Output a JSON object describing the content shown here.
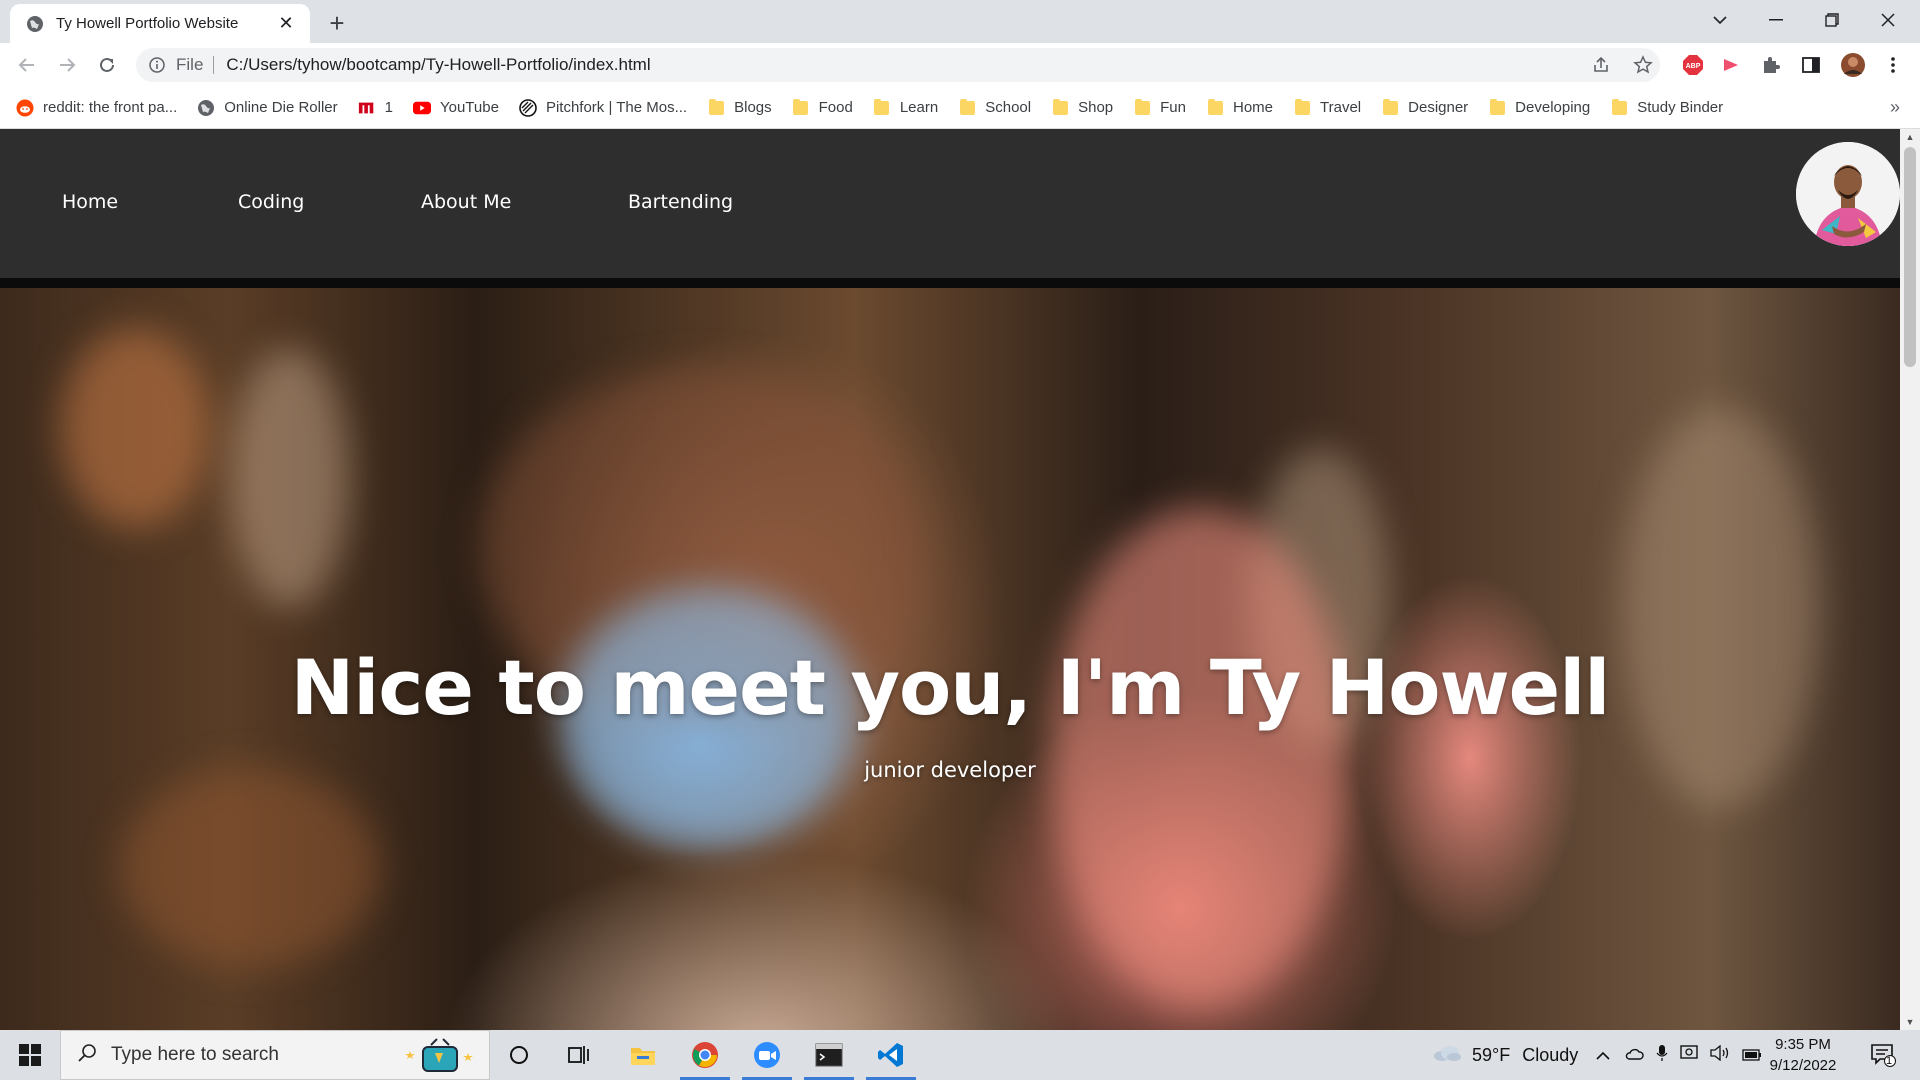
{
  "browser": {
    "tab_title": "Ty Howell Portfolio Website",
    "url_scheme": "File",
    "url": "C:/Users/tyhow/bootcamp/Ty-Howell-Portfolio/index.html",
    "bookmarks": [
      {
        "label": "reddit: the front pa...",
        "icon": "reddit-icon"
      },
      {
        "label": "Online Die Roller",
        "icon": "globe-icon"
      },
      {
        "label": "1",
        "icon": "m-logo-icon"
      },
      {
        "label": "YouTube",
        "icon": "youtube-icon"
      },
      {
        "label": "Pitchfork | The Mos...",
        "icon": "pitchfork-icon"
      },
      {
        "label": "Blogs",
        "icon": "folder-icon"
      },
      {
        "label": "Food",
        "icon": "folder-icon"
      },
      {
        "label": "Learn",
        "icon": "folder-icon"
      },
      {
        "label": "School",
        "icon": "folder-icon"
      },
      {
        "label": "Shop",
        "icon": "folder-icon"
      },
      {
        "label": "Fun",
        "icon": "folder-icon"
      },
      {
        "label": "Home",
        "icon": "folder-icon"
      },
      {
        "label": "Travel",
        "icon": "folder-icon"
      },
      {
        "label": "Designer",
        "icon": "folder-icon"
      },
      {
        "label": "Developing",
        "icon": "folder-icon"
      },
      {
        "label": "Study Binder",
        "icon": "folder-icon"
      }
    ]
  },
  "site": {
    "nav": [
      "Home",
      "Coding",
      "About Me",
      "Bartending"
    ],
    "hero_title": "Nice to meet you, I'm Ty Howell",
    "hero_subtitle": "junior developer"
  },
  "taskbar": {
    "search_placeholder": "Type here to search",
    "weather_temp": "59°F",
    "weather_desc": "Cloudy",
    "time": "9:35 PM",
    "date": "9/12/2022",
    "notification_count": "1"
  },
  "colors": {
    "site_nav_bg": "#2e2e2e",
    "accent_taskbar": "#3a7bd5"
  }
}
